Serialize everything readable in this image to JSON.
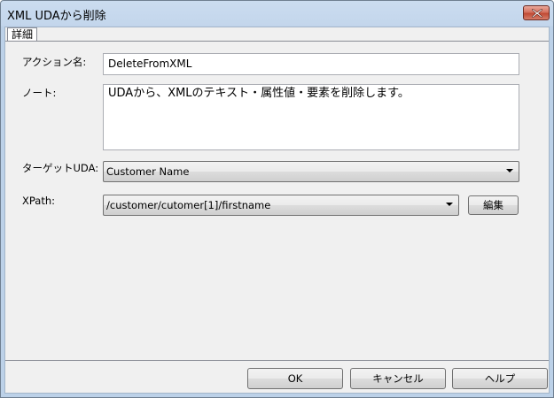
{
  "window": {
    "title": "XML UDAから削除"
  },
  "tabs": [
    {
      "label": "詳細"
    }
  ],
  "form": {
    "action_name_label": "アクション名:",
    "action_name_value": "DeleteFromXML",
    "note_label": "ノート:",
    "note_value": "UDAから、XMLのテキスト・属性値・要素を削除します。",
    "target_uda_label": "ターゲットUDA:",
    "target_uda_value": "Customer Name",
    "xpath_label": "XPath:",
    "xpath_value": "/customer/cutomer[1]/firstname",
    "edit_button": "編集"
  },
  "footer": {
    "ok_label": "OK",
    "cancel_label": "キャンセル",
    "help_label": "ヘルプ"
  },
  "icons": {
    "close": "close-icon",
    "dropdown": "chevron-down-icon"
  }
}
